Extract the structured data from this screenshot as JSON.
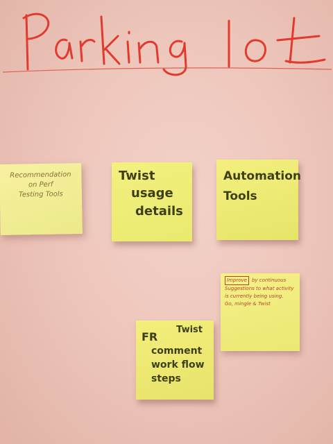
{
  "board": {
    "title": "Parking lot",
    "title_color": "#e23a2e",
    "background_color": "#eec7bc"
  },
  "notes": {
    "recommendation": {
      "line1": "Recommendation",
      "line2": "on Perf",
      "line3": "Testing Tools",
      "color": "#f2ef95"
    },
    "twist_usage": {
      "line1": "Twist",
      "line2": "usage",
      "line3": "details",
      "color": "#efee78"
    },
    "automation": {
      "line1": "Automation",
      "line2": "Tools",
      "color": "#edea74"
    },
    "improve": {
      "tag": "Improve",
      "line1": "by continuous",
      "line2": "Suggestions to what activity",
      "line3": "is currently being using.",
      "line4": "Go, mingle & Twist",
      "color": "#f1ed7e"
    },
    "fr_comment": {
      "line1": "FR",
      "line2": "Twist",
      "line3": "comment",
      "line4": "work flow",
      "line5": "steps",
      "color": "#eee874"
    }
  }
}
